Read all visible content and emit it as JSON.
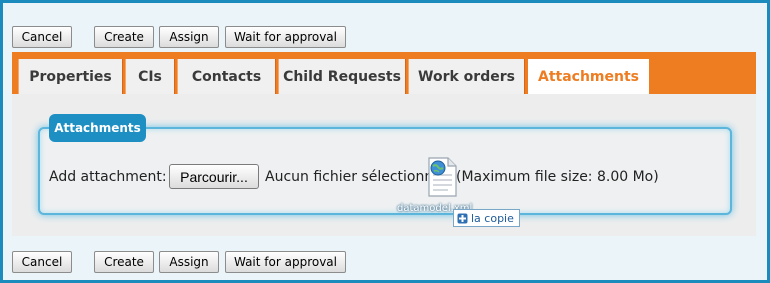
{
  "toolbar_top": {
    "cancel": "Cancel",
    "create": "Create",
    "assign": "Assign",
    "wait": "Wait for approval"
  },
  "tabs": [
    {
      "label": "Properties",
      "active": false
    },
    {
      "label": "CIs",
      "active": false
    },
    {
      "label": "Contacts",
      "active": false
    },
    {
      "label": "Child Requests",
      "active": false
    },
    {
      "label": "Work orders",
      "active": false
    },
    {
      "label": "Attachments",
      "active": true
    }
  ],
  "attachments": {
    "legend": "Attachments",
    "add_label": "Add attachment:",
    "browse_label": "Parcourir...",
    "no_file": "Aucun fichier sélectionné",
    "max_size": "(Maximum file size: 8.00 Mo)"
  },
  "drag_overlay": {
    "filename": "datamodel.xml",
    "action": "la copie",
    "icon": "xml-file-icon"
  },
  "toolbar_bottom": {
    "cancel": "Cancel",
    "create": "Create",
    "assign": "Assign",
    "wait": "Wait for approval"
  },
  "colors": {
    "frame": "#1b8bbd",
    "tab_bar": "#ee7d22",
    "legend": "#1e8fc3"
  }
}
